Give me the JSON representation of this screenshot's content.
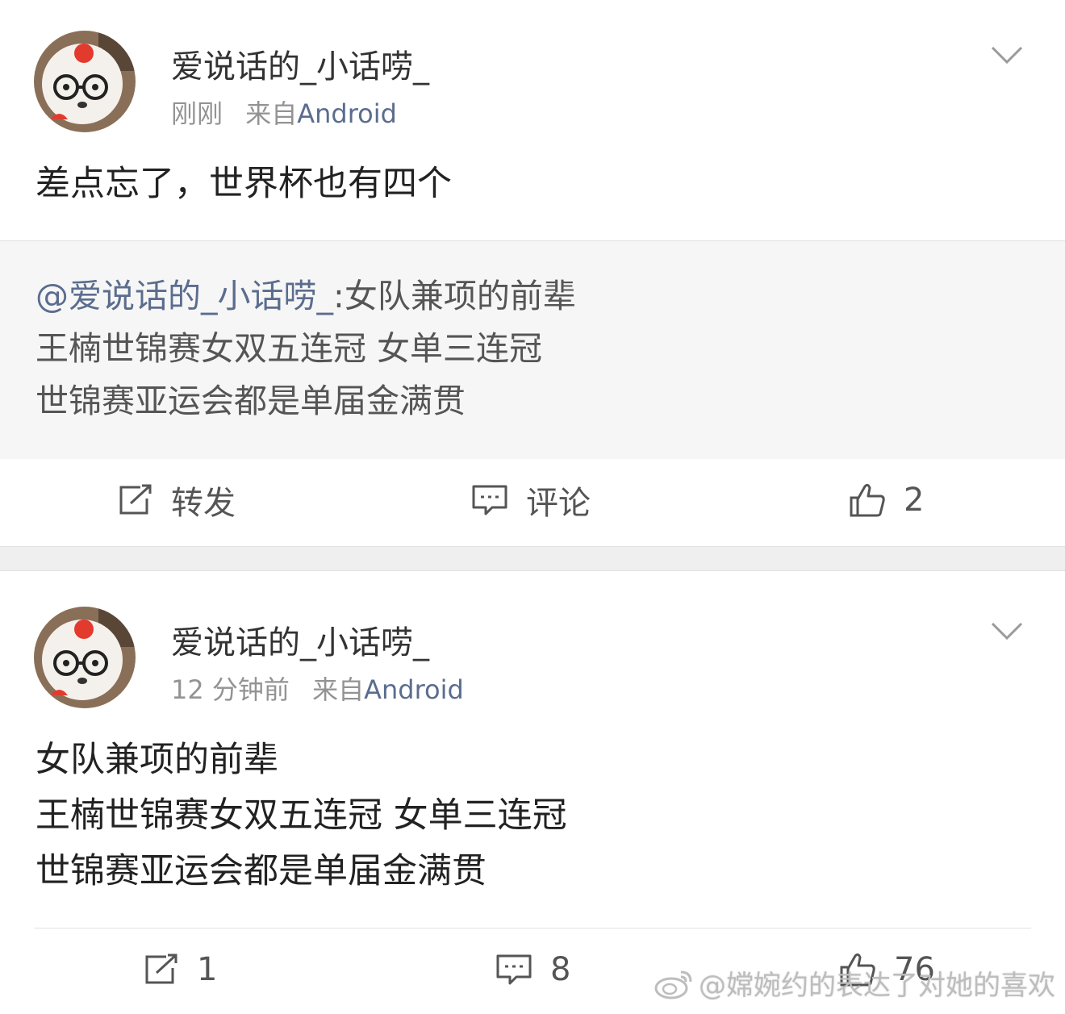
{
  "posts": [
    {
      "username": "爱说话的_小话唠_",
      "time": "刚刚",
      "source_prefix": "来自",
      "source": "Android",
      "text_lines": [
        "差点忘了，世界杯也有四个"
      ],
      "repost": {
        "mention": "@爱说话的_小话唠_",
        "first_line_rest": ":女队兼项的前辈",
        "lines": [
          "王楠世锦赛女双五连冠  女单三连冠",
          "世锦赛亚运会都是单届金满贯"
        ]
      },
      "actions": {
        "repost": "转发",
        "comment": "评论",
        "like": "2"
      }
    },
    {
      "username": "爱说话的_小话唠_",
      "time": "12 分钟前",
      "source_prefix": "来自",
      "source": "Android",
      "text_lines": [
        "女队兼项的前辈",
        "王楠世锦赛女双五连冠  女单三连冠",
        "世锦赛亚运会都是单届金满贯"
      ],
      "actions": {
        "repost": "1",
        "comment": "8",
        "like": "76"
      }
    }
  ],
  "watermark": "@嫦婉约的表达了对她的喜欢",
  "icons": {
    "avatar": "dog-with-glasses-avatar",
    "menu": "chevron-down-icon",
    "repost": "repost-icon",
    "comment": "comment-icon",
    "like": "thumbs-up-icon",
    "watermark": "weibo-logo-icon"
  },
  "colors": {
    "link": "#5b6d8e",
    "meta": "#939393",
    "separator": "#efefef",
    "repost_bg": "#f6f6f6"
  }
}
